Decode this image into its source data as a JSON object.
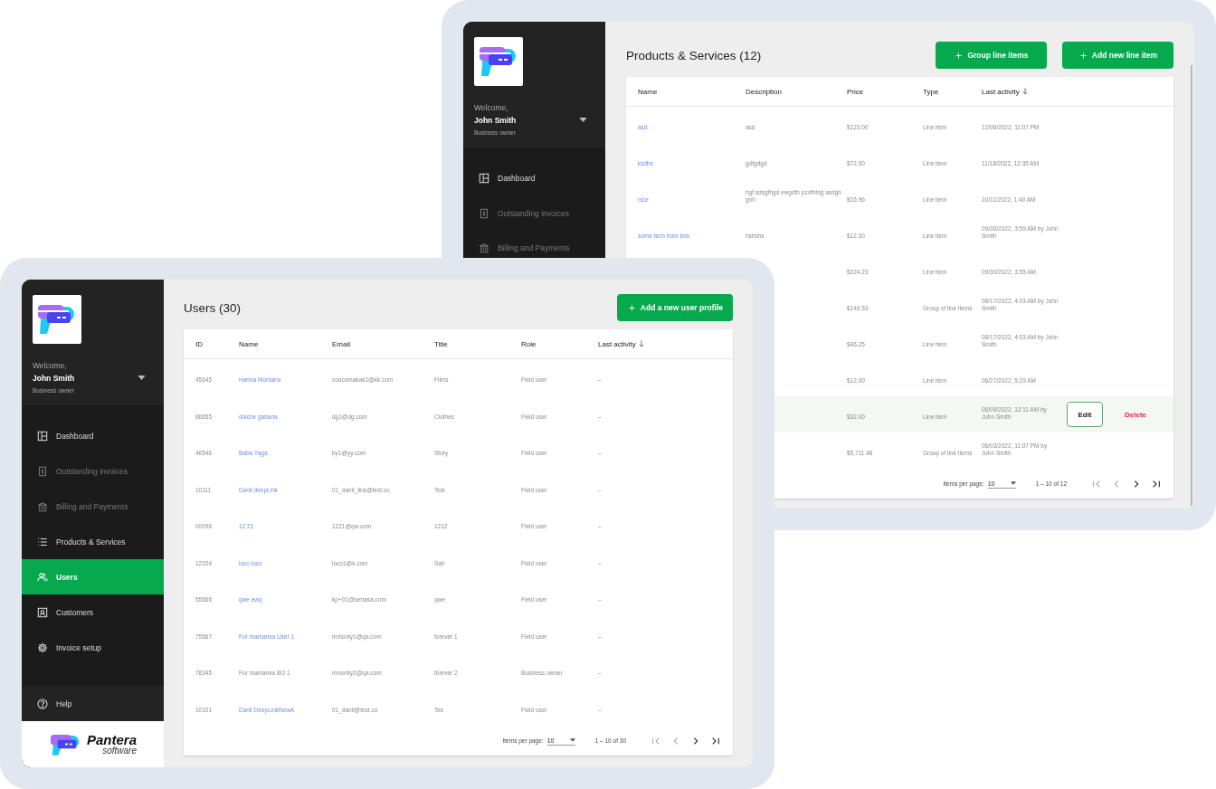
{
  "back_window": {
    "sidebar": {
      "welcome": "Welcome,",
      "user": "John Smith",
      "role": "Business owner",
      "items": [
        {
          "label": "Dashboard",
          "kind": "dashboard",
          "disabled": false,
          "selected": false
        },
        {
          "label": "Outstanding invoices",
          "kind": "invoice",
          "disabled": true,
          "selected": false
        },
        {
          "label": "Billing and Payments",
          "kind": "bank",
          "disabled": true,
          "selected": false
        }
      ]
    },
    "title": "Products & Services (12)",
    "buttons": [
      {
        "label": "Group line items"
      },
      {
        "label": "Add new line item"
      }
    ],
    "columns": [
      {
        "label": "Name",
        "sorted": false
      },
      {
        "label": "Description",
        "sorted": false
      },
      {
        "label": "Price",
        "sorted": false
      },
      {
        "label": "Type",
        "sorted": false
      },
      {
        "label": "Last activity",
        "sorted": true
      }
    ],
    "rows": [
      {
        "name": "asd",
        "description": "asd",
        "price": "$123.00",
        "type": "Line item",
        "last_activity": "12/06/2022, 11:07 PM",
        "hovered": false
      },
      {
        "name": "ksdhs",
        "description": "gdfgdgd",
        "price": "$72.00",
        "type": "Line item",
        "last_activity": "11/18/2022, 12:35 AM",
        "hovered": false
      },
      {
        "name": "nice",
        "description": "hgf sdsgfhgd ewgdfh pzxfhfdg asdgh gnh",
        "price": "$16.96",
        "type": "Line item",
        "last_activity": "10/11/2022, 1:40 AM",
        "hovered": false
      },
      {
        "name": "some item from bris",
        "description": "hshshs",
        "price": "$12.00",
        "type": "Line item",
        "last_activity": "09/30/2022, 3:59 AM by John Smith",
        "hovered": false
      },
      {
        "price": "$224.23",
        "type": "Line item",
        "last_activity": "09/30/2022, 3:55 AM",
        "hovered": false
      },
      {
        "price": "$149.53",
        "type": "Group of line items",
        "last_activity": "08/17/2022, 4:03 AM by John Smith",
        "hovered": false
      },
      {
        "price": "$46.25",
        "type": "Line item",
        "last_activity": "08/17/2022, 4:03 AM by John Smith",
        "hovered": false
      },
      {
        "price": "$12.00",
        "type": "Line item",
        "last_activity": "06/27/2022, 5:29 AM",
        "hovered": false
      },
      {
        "price": "$32.00",
        "type": "Line item",
        "last_activity": "06/09/2022, 12:11 AM by John Smith",
        "hovered": true,
        "actions": [
          {
            "label": "Edit",
            "kind": "outline"
          },
          {
            "label": "Delete",
            "kind": "danger"
          }
        ]
      },
      {
        "price": "$5,711.48",
        "type": "Group of line items",
        "last_activity": "06/03/2022, 11:07 PM by John Smith",
        "hovered": false
      }
    ],
    "pagination": {
      "label": "Items per page:",
      "page_size": "10",
      "range": "1 – 10 of 12",
      "at_first_page": true
    }
  },
  "front_window": {
    "sidebar": {
      "welcome": "Welcome,",
      "user": "John Smith",
      "role": "Business owner",
      "items": [
        {
          "label": "Dashboard",
          "kind": "dashboard",
          "disabled": false,
          "selected": false
        },
        {
          "label": "Outstanding invoices",
          "kind": "invoice",
          "disabled": true,
          "selected": false
        },
        {
          "label": "Billing and Payments",
          "kind": "bank",
          "disabled": true,
          "selected": false
        },
        {
          "label": "Products & Services",
          "kind": "list",
          "disabled": false,
          "selected": false
        },
        {
          "label": "Users",
          "kind": "users",
          "disabled": false,
          "selected": true
        },
        {
          "label": "Customers",
          "kind": "contact",
          "disabled": false,
          "selected": false
        },
        {
          "label": "Invoice setup",
          "kind": "gear",
          "disabled": false,
          "selected": false
        }
      ],
      "help": "Help",
      "brand": {
        "name": "Pantera",
        "tagline": "software"
      }
    },
    "title": "Users (30)",
    "buttons": [
      {
        "label": "Add a new user profile"
      }
    ],
    "columns": [
      {
        "label": "ID",
        "sorted": false
      },
      {
        "label": "Name",
        "sorted": false
      },
      {
        "label": "Email",
        "sorted": false
      },
      {
        "label": "Title",
        "sorted": false
      },
      {
        "label": "Role",
        "sorted": false
      },
      {
        "label": "Last activity",
        "sorted": true
      }
    ],
    "rows": [
      {
        "id": "45645",
        "name": "Hanna Montana",
        "name_link": true,
        "email": "coocomakak1@kk.com",
        "title": "Films",
        "role": "Field user",
        "last_activity": "–"
      },
      {
        "id": "86655",
        "name": "dolche gabana",
        "name_link": true,
        "email": "dg1@dg.com",
        "title": "Clothes",
        "role": "Field user",
        "last_activity": "–"
      },
      {
        "id": "46546",
        "name": "Baba Yaga",
        "name_link": true,
        "email": "by1@yy.com",
        "title": "Story",
        "role": "Field user",
        "last_activity": "–"
      },
      {
        "id": "10111",
        "name": "Danil deepLink",
        "name_link": true,
        "email": "01_danil_link@test.co",
        "title": "Test",
        "role": "Field user",
        "last_activity": "–"
      },
      {
        "id": "00098",
        "name": "12 21",
        "name_link": true,
        "email": "1221@qw.com",
        "title": "1212",
        "role": "Field user",
        "last_activity": "–"
      },
      {
        "id": "12204",
        "name": "loco loco",
        "name_link": true,
        "email": "loco1@k.com",
        "title": "Sail",
        "role": "Field user",
        "last_activity": "–"
      },
      {
        "id": "55566",
        "name": "qwe ewq",
        "name_link": true,
        "email": "kp+01@sertasa.com",
        "title": "qwe",
        "role": "Field user",
        "last_activity": "–"
      },
      {
        "id": "75567",
        "name": "For mamamia User 1",
        "name_link": true,
        "email": "mmonty1@qa.com",
        "title": "forever 1",
        "role": "Field user",
        "last_activity": "–"
      },
      {
        "id": "78345",
        "name": "For mamamia BO 1",
        "name_link": false,
        "email": "mmonty2@qa.com",
        "title": "forever 2",
        "role": "Business owner",
        "last_activity": "–"
      },
      {
        "id": "10101",
        "name": "Danil DeepLinkNewA",
        "name_link": true,
        "email": "01_danil@test.co",
        "title": "Tes",
        "role": "Field user",
        "last_activity": "–"
      }
    ],
    "pagination": {
      "label": "Items per page:",
      "page_size": "10",
      "range": "1 – 10 of 30",
      "at_first_page": true
    }
  }
}
